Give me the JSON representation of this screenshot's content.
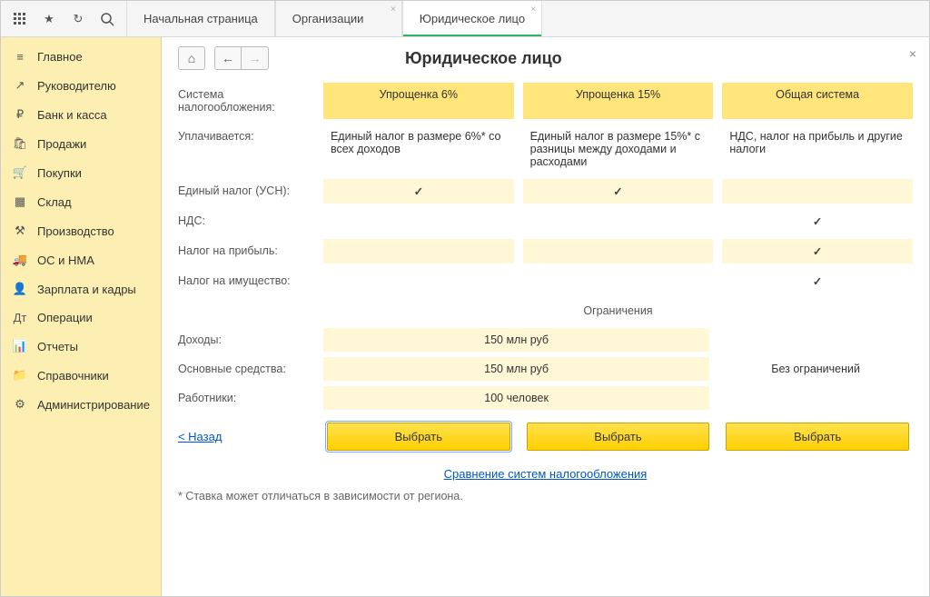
{
  "tabs": [
    {
      "label": "Начальная страница",
      "closable": false
    },
    {
      "label": "Организации",
      "closable": true
    },
    {
      "label": "Юридическое лицо",
      "closable": true,
      "active": true
    }
  ],
  "sidebar": [
    {
      "icon": "≡",
      "label": "Главное"
    },
    {
      "icon": "↗",
      "label": "Руководителю"
    },
    {
      "icon": "₽",
      "label": "Банк и касса"
    },
    {
      "icon": "🛍",
      "label": "Продажи"
    },
    {
      "icon": "🛒",
      "label": "Покупки"
    },
    {
      "icon": "▦",
      "label": "Склад"
    },
    {
      "icon": "⚒",
      "label": "Производство"
    },
    {
      "icon": "🚚",
      "label": "ОС и НМА"
    },
    {
      "icon": "👤",
      "label": "Зарплата и кадры"
    },
    {
      "icon": "Дт",
      "label": "Операции"
    },
    {
      "icon": "📊",
      "label": "Отчеты"
    },
    {
      "icon": "📁",
      "label": "Справочники"
    },
    {
      "icon": "⚙",
      "label": "Администрирование"
    }
  ],
  "page": {
    "title": "Юридическое лицо",
    "row_tax_system_label": "Система налогообложения:",
    "columns": {
      "usn6": "Упрощенка 6%",
      "usn15": "Упрощенка 15%",
      "osno": "Общая система"
    },
    "row_paid_label": "Уплачивается:",
    "paid": {
      "usn6": "Единый налог в размере 6%* со всех доходов",
      "usn15": "Единый налог в размере 15%* с разницы между доходами и расходами",
      "osno": "НДС, налог на прибыль и другие налоги"
    },
    "tax_rows": {
      "usn_tax": "Единый налог (УСН):",
      "vat": "НДС:",
      "profit_tax": "Налог на прибыль:",
      "property_tax": "Налог на имущество:"
    },
    "limits_title": "Ограничения",
    "limit_rows": {
      "income_label": "Доходы:",
      "income_value": "150 млн руб",
      "assets_label": "Основные средства:",
      "assets_value": "150 млн руб",
      "employees_label": "Работники:",
      "employees_value": "100 человек",
      "no_limits": "Без ограничений"
    },
    "back_link": "< Назад",
    "select_button": "Выбрать",
    "compare_link": "Сравнение систем налогообложения",
    "footnote": "* Ставка может отличаться в зависимости от региона."
  }
}
